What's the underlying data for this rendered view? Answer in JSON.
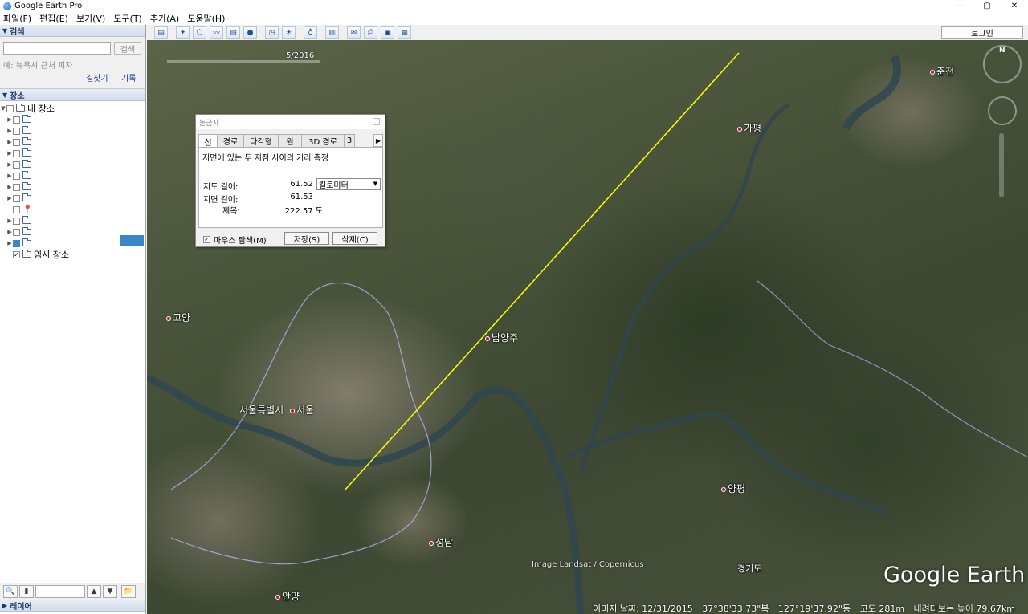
{
  "window": {
    "title": "Google Earth Pro",
    "min": "—",
    "max": "▢",
    "close": "✕"
  },
  "menu": [
    "파일(F)",
    "편집(E)",
    "보기(V)",
    "도구(T)",
    "추가(A)",
    "도움말(H)"
  ],
  "search": {
    "header": "검색",
    "placeholder": "",
    "button": "검색",
    "hint": "예: 뉴욕시 근처 피자",
    "directions": "길찾기",
    "history": "기록"
  },
  "places": {
    "header": "장소",
    "my_places": "내 장소",
    "temporary": "임시 장소"
  },
  "layers": {
    "header": "레이어"
  },
  "toolbar": {
    "login": "로그인"
  },
  "icons": {
    "sidebar_toggle": "sidebar-icon",
    "placemark": "placemark-icon",
    "polygon": "polygon-icon",
    "path": "path-icon",
    "overlay": "image-overlay-icon",
    "tour": "record-tour-icon",
    "history": "historical-imagery-icon",
    "sun": "sun-icon",
    "planets": "planet-icon",
    "ruler": "ruler-icon",
    "email": "email-icon",
    "print": "print-icon",
    "save_image": "save-image-icon",
    "maps": "maps-icon"
  },
  "ruler": {
    "title": "눈금자",
    "tabs": [
      "선",
      "경로",
      "다각형",
      "원",
      "3D 경로",
      "3"
    ],
    "description": "지면에 있는 두 지점 사이의 거리 측정",
    "map_length_label": "지도 길이:",
    "map_length_value": "61.52",
    "unit": "킬로미터",
    "ground_length_label": "지면 길이:",
    "ground_length_value": "61.53",
    "heading_label": "제목:",
    "heading_value": "222.57 도",
    "mouse_nav": "마우스 탐색(M)",
    "save": "저장(S)",
    "clear": "삭제(C)"
  },
  "map": {
    "time_date": "5/2016",
    "labels": {
      "namyangju": "남양주",
      "seoul": "서울특별시",
      "seoul2": "서울",
      "goyang": "고양",
      "seongnam": "성남",
      "anyang": "안양",
      "gapyeong": "가평",
      "yangpyeong": "양평",
      "chuncheon": "춘천",
      "gyeonggi": "경기도"
    },
    "imagery_credit": "Image Landsat / Copernicus",
    "watermark": "Google Earth",
    "compass_n": "N"
  },
  "status": {
    "image_date": "이미지 날짜: 12/31/2015",
    "lat": "37°38'33.73\"북",
    "lon": "127°19'37.92\"동",
    "elevation": "고도  281m",
    "eye_alt": "내려다보는 높이  79.67km"
  },
  "colors": {
    "accent": "#3987c9",
    "ruler_line": "#ffff00",
    "boundary": "#b9b9ff"
  }
}
